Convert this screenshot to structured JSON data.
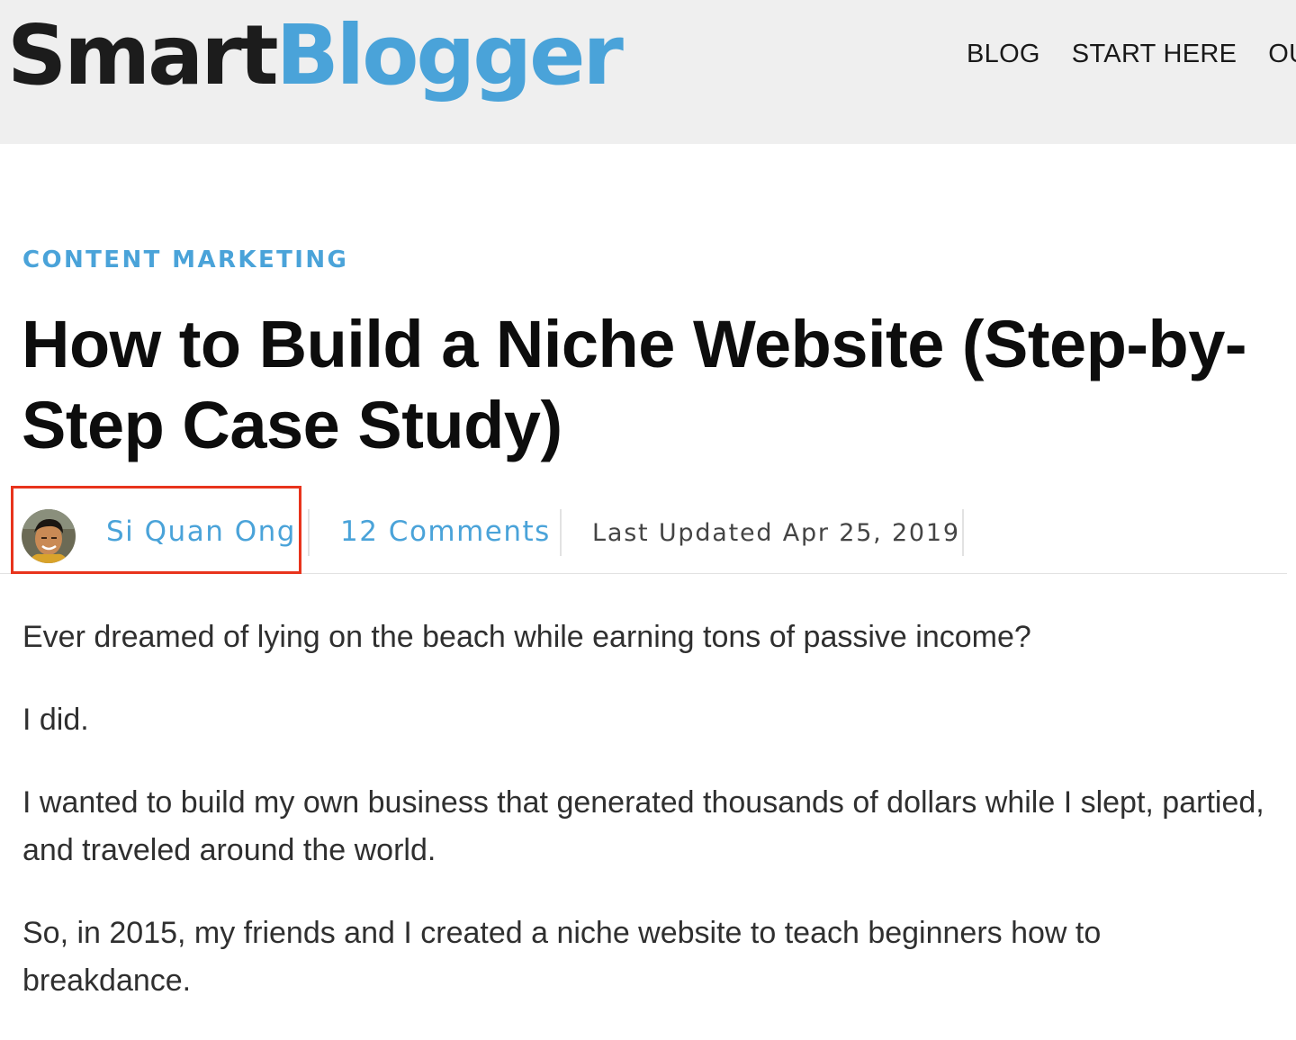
{
  "header": {
    "logo_part1": "Smart",
    "logo_part2": "Blogger",
    "nav": [
      "BLOG",
      "START HERE",
      "OUR P"
    ]
  },
  "article": {
    "category": "CONTENT MARKETING",
    "title": "How to Build a Niche Website (Step-by-Step Case Study)",
    "author": "Si Quan Ong",
    "comments": "12 Comments",
    "updated": "Last Updated Apr 25, 2019",
    "paragraphs": [
      "Ever dreamed of lying on the beach while earning tons of passive income?",
      "I did.",
      "I wanted to build my own business that generated thousands of dollars while I slept, partied, and traveled around the world.",
      "So, in 2015, my friends and I created a niche website to teach beginners how to breakdance."
    ]
  },
  "colors": {
    "accent": "#4aa3d9",
    "highlight_box": "#e8341c",
    "header_bg": "#efefef"
  }
}
